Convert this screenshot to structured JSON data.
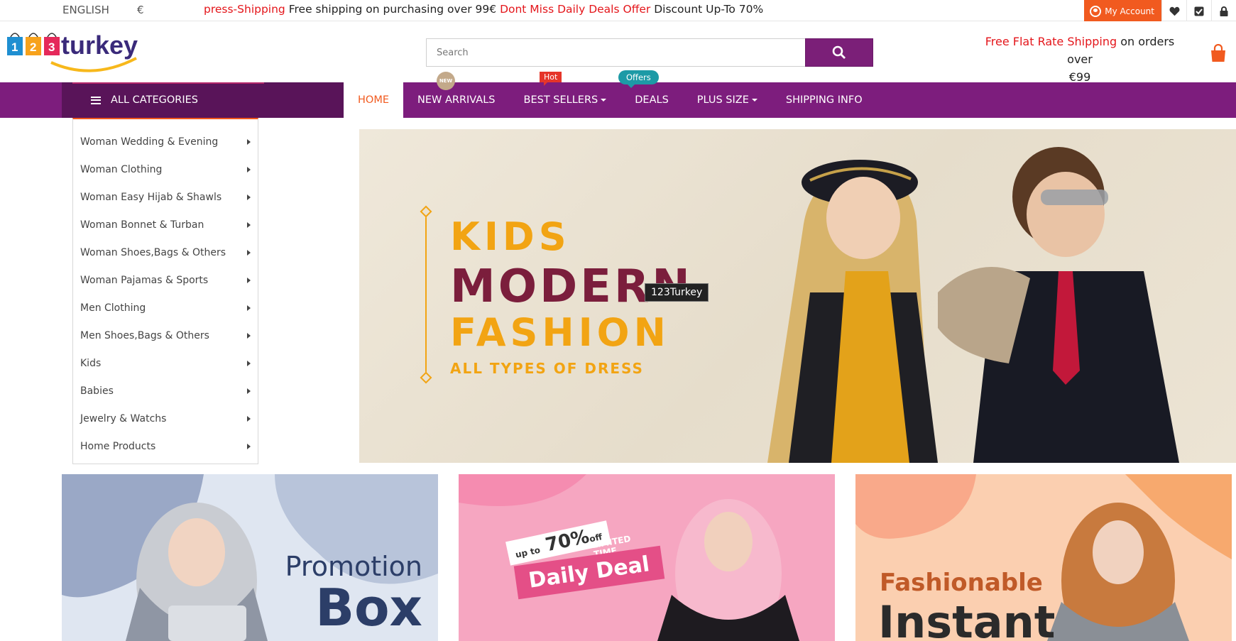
{
  "topbar": {
    "language": "ENGLISH",
    "currency": "€",
    "marquee": {
      "part1": "press-Shipping",
      "part2": " Free shipping on purchasing over 99€ ",
      "part3": "Dont Miss Daily Deals Offer",
      "part4": " Discount Up-To 70%"
    },
    "account_label": "My Account",
    "icons": [
      "user-icon",
      "heart-icon",
      "checkbox-icon",
      "lock-icon"
    ]
  },
  "header": {
    "logo_text": "123turkey",
    "search": {
      "placeholder": "Search"
    },
    "shipping": {
      "highlight": "Free Flat Rate Shipping",
      "rest": " on orders over",
      "amount": "€99"
    }
  },
  "nav": {
    "all_categories": "ALL CATEGORIES",
    "links": [
      {
        "label": "HOME",
        "active": true
      },
      {
        "label": "NEW ARRIVALS",
        "badge": "NEW"
      },
      {
        "label": "BEST SELLERS",
        "badge": "Hot",
        "dropdown": true
      },
      {
        "label": "DEALS",
        "badge": "Offers"
      },
      {
        "label": "PLUS SIZE",
        "dropdown": true
      },
      {
        "label": "SHIPPING INFO"
      }
    ]
  },
  "categories": [
    "Woman Wedding & Evening",
    "Woman Clothing",
    "Woman Easy Hijab & Shawls",
    "Woman Bonnet & Turban",
    "Woman Shoes,Bags & Others",
    "Woman Pajamas & Sports",
    "Men Clothing",
    "Men Shoes,Bags & Others",
    "Kids",
    "Babies",
    "Jewelry & Watchs",
    "Home Products"
  ],
  "hero": {
    "line1": "KIDS",
    "line2": "MODERN",
    "line3": "FASHION",
    "line4": "ALL TYPES OF DRESS",
    "tooltip": "123Turkey"
  },
  "promos": {
    "p1": {
      "line1": "Promotion",
      "line2": "Box"
    },
    "p2": {
      "upto": "up to",
      "percent": "70%",
      "off": "off",
      "limited": "LIMITED TIME ONLY",
      "deal": "Daily Deal"
    },
    "p3": {
      "line1": "Fashionable",
      "line2": "Instant"
    }
  },
  "colors": {
    "brand_purple": "#7d1d7d",
    "dark_purple": "#591459",
    "accent_orange": "#f15a1f",
    "alert_red": "#e4161b"
  }
}
